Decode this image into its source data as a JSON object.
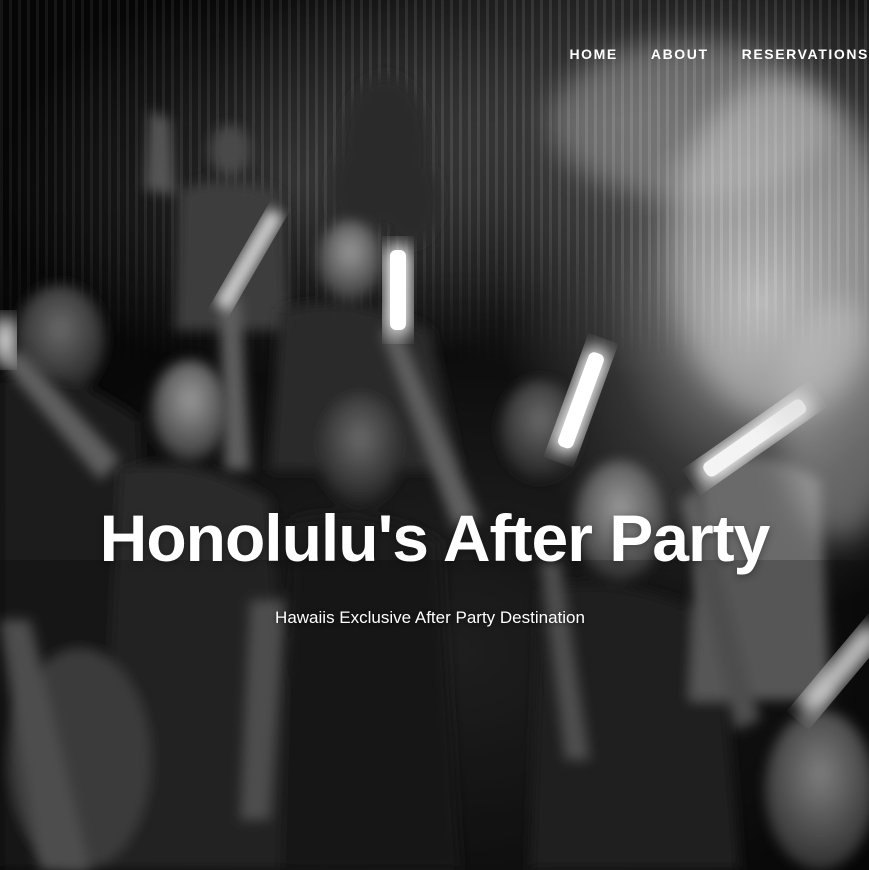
{
  "nav": {
    "items": [
      {
        "label": "HOME"
      },
      {
        "label": "ABOUT"
      },
      {
        "label": "RESERVATIONS"
      }
    ]
  },
  "hero": {
    "title": "Honolulu's After Party",
    "subtitle": "Hawaiis Exclusive After Party Destination",
    "image_style": "black-and-white nightclub crowd photo with glowing light sticks"
  }
}
